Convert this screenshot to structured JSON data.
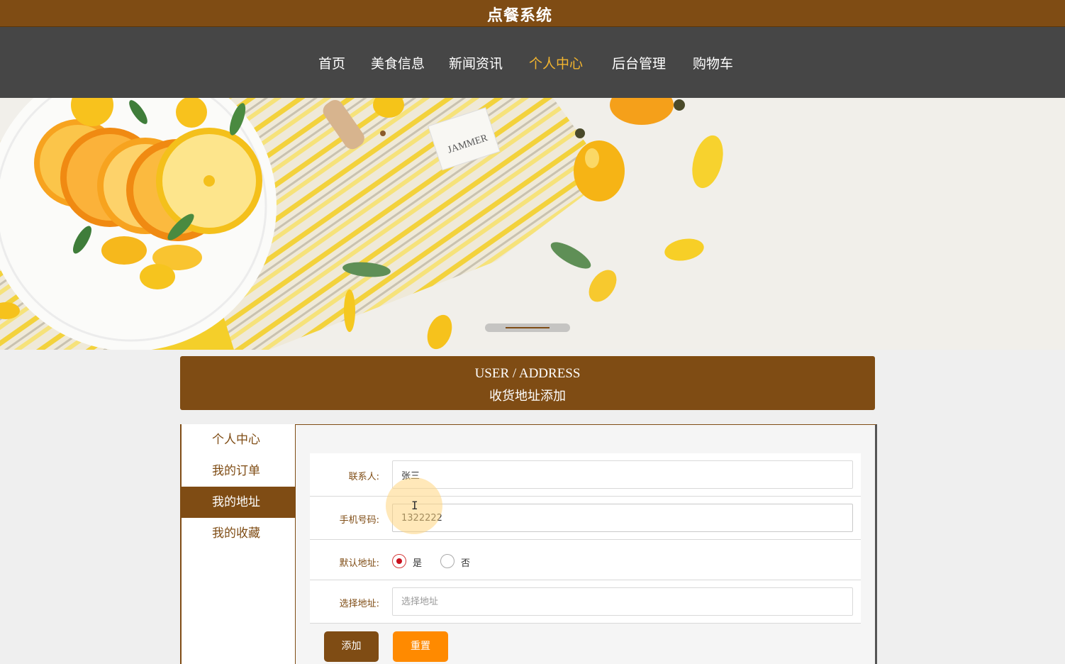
{
  "app": {
    "title": "点餐系统"
  },
  "nav": {
    "items": [
      {
        "label": "首页"
      },
      {
        "label": "美食信息"
      },
      {
        "label": "新闻资讯"
      },
      {
        "label": "个人中心",
        "active": true
      },
      {
        "label": "后台管理"
      },
      {
        "label": "购物车"
      }
    ]
  },
  "banner": {
    "tag_text": "JAMMER",
    "slides": 2,
    "active_slide": 1
  },
  "section": {
    "title_en": "USER / ADDRESS",
    "title_cn": "收货地址添加"
  },
  "sidebar": {
    "items": [
      {
        "label": "个人中心"
      },
      {
        "label": "我的订单"
      },
      {
        "label": "我的地址",
        "active": true
      },
      {
        "label": "我的收藏"
      }
    ]
  },
  "form": {
    "contact": {
      "label": "联系人:",
      "value": "张三"
    },
    "phone": {
      "label": "手机号码:",
      "value": "1322222"
    },
    "default": {
      "label": "默认地址:",
      "yes": "是",
      "no": "否",
      "selected": "是"
    },
    "address": {
      "label": "选择地址:",
      "placeholder": "选择地址"
    },
    "add_button": "添加",
    "reset_button": "重置"
  },
  "colors": {
    "brand": "#7f4c14",
    "nav_bg": "#464646",
    "active_nav": "#f2b42f",
    "reset": "#ff8a00"
  }
}
